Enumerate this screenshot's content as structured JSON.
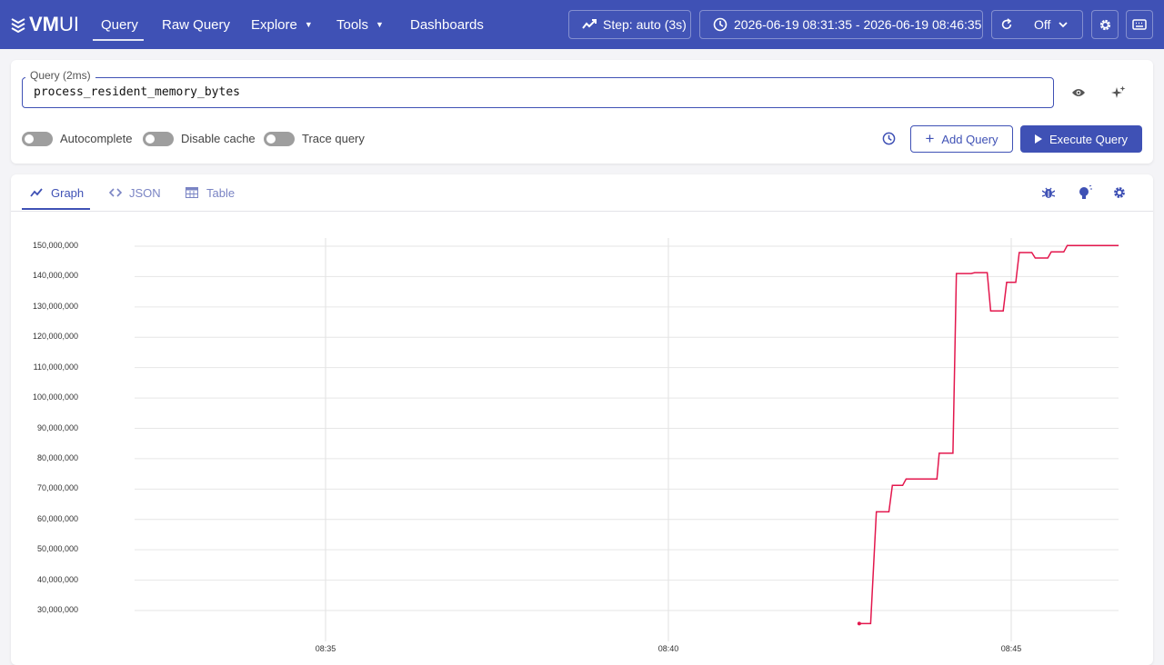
{
  "header": {
    "logo_prefix": "VM",
    "logo_suffix": "UI",
    "nav": [
      {
        "label": "Query",
        "active": true,
        "dropdown": false
      },
      {
        "label": "Raw Query",
        "active": false,
        "dropdown": false
      },
      {
        "label": "Explore",
        "active": false,
        "dropdown": true
      },
      {
        "label": "Tools",
        "active": false,
        "dropdown": true
      },
      {
        "label": "Dashboards",
        "active": false,
        "dropdown": false
      }
    ],
    "step_label": "Step: auto (3s)",
    "time_range_label": "2026-06-19 08:31:35 - 2026-06-19 08:46:35",
    "refresh_label": "Off",
    "accent_color": "#3f51b5"
  },
  "query": {
    "label": "Query (2ms)",
    "value": "process_resident_memory_bytes",
    "toggles": [
      {
        "label": "Autocomplete",
        "on": false
      },
      {
        "label": "Disable cache",
        "on": false
      },
      {
        "label": "Trace query",
        "on": false
      }
    ],
    "add_query_label": "Add Query",
    "execute_label": "Execute Query"
  },
  "tabs": [
    {
      "label": "Graph",
      "active": true
    },
    {
      "label": "JSON",
      "active": false
    },
    {
      "label": "Table",
      "active": false
    }
  ],
  "icons": {
    "header": [
      "settings-icon",
      "keyboard-icon",
      "refresh-icon",
      "clock-icon",
      "step-chart-icon"
    ],
    "query": [
      "eye-icon",
      "sparkle-icon",
      "history-icon"
    ],
    "tabs_right": [
      "bug-icon",
      "lightbulb-icon",
      "settings-icon"
    ]
  },
  "chart_data": {
    "type": "line",
    "series_color": "#e3174d",
    "ylim": [
      25000000,
      150000000
    ],
    "y_ticks": [
      {
        "value": 150000000,
        "label": "150,000,000"
      },
      {
        "value": 140000000,
        "label": "140,000,000"
      },
      {
        "value": 130000000,
        "label": "130,000,000"
      },
      {
        "value": 120000000,
        "label": "120,000,000"
      },
      {
        "value": 110000000,
        "label": "110,000,000"
      },
      {
        "value": 100000000,
        "label": "100,000,000"
      },
      {
        "value": 90000000,
        "label": "90,000,000"
      },
      {
        "value": 80000000,
        "label": "80,000,000"
      },
      {
        "value": 70000000,
        "label": "70,000,000"
      },
      {
        "value": 60000000,
        "label": "60,000,000"
      },
      {
        "value": 50000000,
        "label": "50,000,000"
      },
      {
        "value": 40000000,
        "label": "40,000,000"
      },
      {
        "value": 30000000,
        "label": "30,000,000"
      }
    ],
    "x_ticks": [
      {
        "time": "08:35",
        "label": "08:35"
      },
      {
        "time": "08:40",
        "label": "08:40"
      },
      {
        "time": "08:45",
        "label": "08:45"
      }
    ],
    "xlim": [
      "08:31:35",
      "08:46:35"
    ],
    "grid": true,
    "points": [
      [
        "08:42:47",
        25700000
      ],
      [
        "08:42:53",
        25700000
      ],
      [
        "08:42:57",
        25700000
      ],
      [
        "08:43:02",
        62500000
      ],
      [
        "08:43:13",
        62500000
      ],
      [
        "08:43:16",
        71200000
      ],
      [
        "08:43:25",
        71200000
      ],
      [
        "08:43:28",
        73300000
      ],
      [
        "08:43:55",
        73300000
      ],
      [
        "08:43:57",
        81800000
      ],
      [
        "08:44:09",
        81800000
      ],
      [
        "08:44:12",
        141000000
      ],
      [
        "08:44:25",
        141000000
      ],
      [
        "08:44:28",
        141300000
      ],
      [
        "08:44:39",
        141300000
      ],
      [
        "08:44:42",
        128700000
      ],
      [
        "08:44:53",
        128700000
      ],
      [
        "08:44:56",
        138100000
      ],
      [
        "08:45:04",
        138100000
      ],
      [
        "08:45:07",
        147900000
      ],
      [
        "08:45:18",
        147900000
      ],
      [
        "08:45:21",
        146100000
      ],
      [
        "08:45:32",
        146100000
      ],
      [
        "08:45:35",
        148100000
      ],
      [
        "08:45:46",
        148100000
      ],
      [
        "08:45:49",
        150200000
      ],
      [
        "08:46:34",
        150200000
      ]
    ]
  }
}
